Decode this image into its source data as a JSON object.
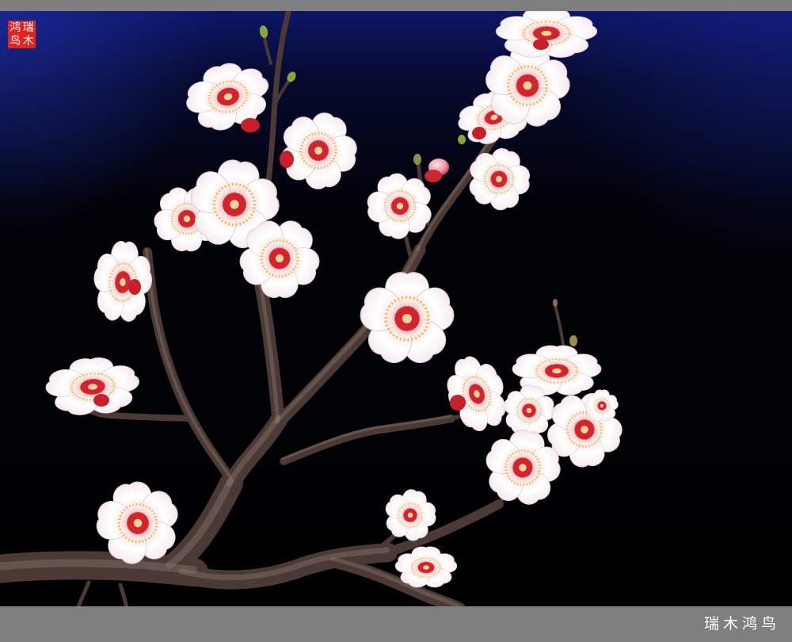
{
  "watermark": {
    "text": "瑞木鸿鸟"
  },
  "seal": {
    "chars": [
      "瑞",
      "木",
      "鸿",
      "鸟"
    ],
    "color": "#e02420",
    "char_color": "#ffffff"
  },
  "colors": {
    "frame": "#7f7f7f",
    "background": "#000000",
    "sky_tint": "#0c1666",
    "petal": "#ffffff",
    "petal_tint": "#f0a3ad",
    "flower_center": "#d3232b",
    "stamen_tip": "#e6b632",
    "bud": "#8aa63a",
    "branch": "#4b3935",
    "seal": "#e02420"
  }
}
